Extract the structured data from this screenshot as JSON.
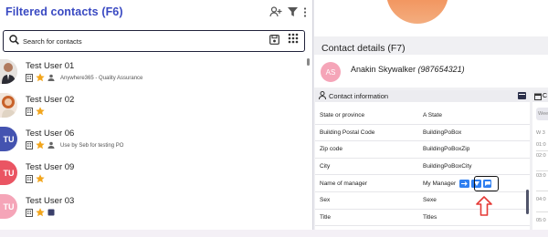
{
  "left_panel": {
    "title": "Filtered contacts",
    "shortcut": "(F6)",
    "header_icons": [
      "add-person-icon",
      "filter-icon",
      "more-vert-icon"
    ]
  },
  "search": {
    "placeholder": "Search for contacts",
    "icons": [
      "search-icon",
      "save-search-icon",
      "dialpad-icon"
    ]
  },
  "contacts": [
    {
      "name": "Test User 01",
      "avatar": "photo-man",
      "initials": "",
      "note": "Anywhere365 - Quality Assurance",
      "icons": [
        "building-icon",
        "star-icon",
        "person-badge-icon"
      ]
    },
    {
      "name": "Test User 02",
      "avatar": "photo-woman",
      "initials": "",
      "note": "",
      "icons": [
        "building-icon",
        "star-icon"
      ]
    },
    {
      "name": "Test User 06",
      "avatar": "initials",
      "initials": "TU",
      "color": "#4453b0",
      "note": "Use by Seb for testing PO",
      "icons": [
        "building-icon",
        "star-icon",
        "person-badge-icon"
      ]
    },
    {
      "name": "Test User 09",
      "avatar": "initials",
      "initials": "TU",
      "color": "#ea5563",
      "note": "",
      "icons": [
        "building-icon",
        "star-icon"
      ]
    },
    {
      "name": "Test User 03",
      "avatar": "initials",
      "initials": "TU",
      "color": "#f5a5b8",
      "note": "",
      "icons": [
        "building-icon",
        "star-icon",
        "notes-icon"
      ]
    }
  ],
  "contact_details": {
    "title": "Contact details (F7)",
    "avatar_initials": "AS",
    "avatar_color": "#f5a5b8",
    "name": "Anakin Skywalker",
    "phone": "(987654321)",
    "section_label": "Contact information",
    "rows": [
      {
        "key": "State or province",
        "value": "A State"
      },
      {
        "key": "Building Postal Code",
        "value": "BuildingPoBox"
      },
      {
        "key": "Zip code",
        "value": "BuildingPoBoxZip"
      },
      {
        "key": "City",
        "value": "BuildingPoBoxCity"
      },
      {
        "key": "Name of manager",
        "value": "My Manager"
      },
      {
        "key": "Sex",
        "value": "Sexe"
      },
      {
        "key": "Title",
        "value": "Titles"
      }
    ]
  },
  "side_column": {
    "field_text": "Wee",
    "timeline": [
      "W 3",
      "01:0",
      "02:0",
      "03:0",
      "04:0",
      "05:0"
    ]
  },
  "colors": {
    "accent": "#3949c2",
    "action_blue": "#2f7ff0",
    "star": "#f2a51c",
    "arrow_red": "#e53935"
  }
}
